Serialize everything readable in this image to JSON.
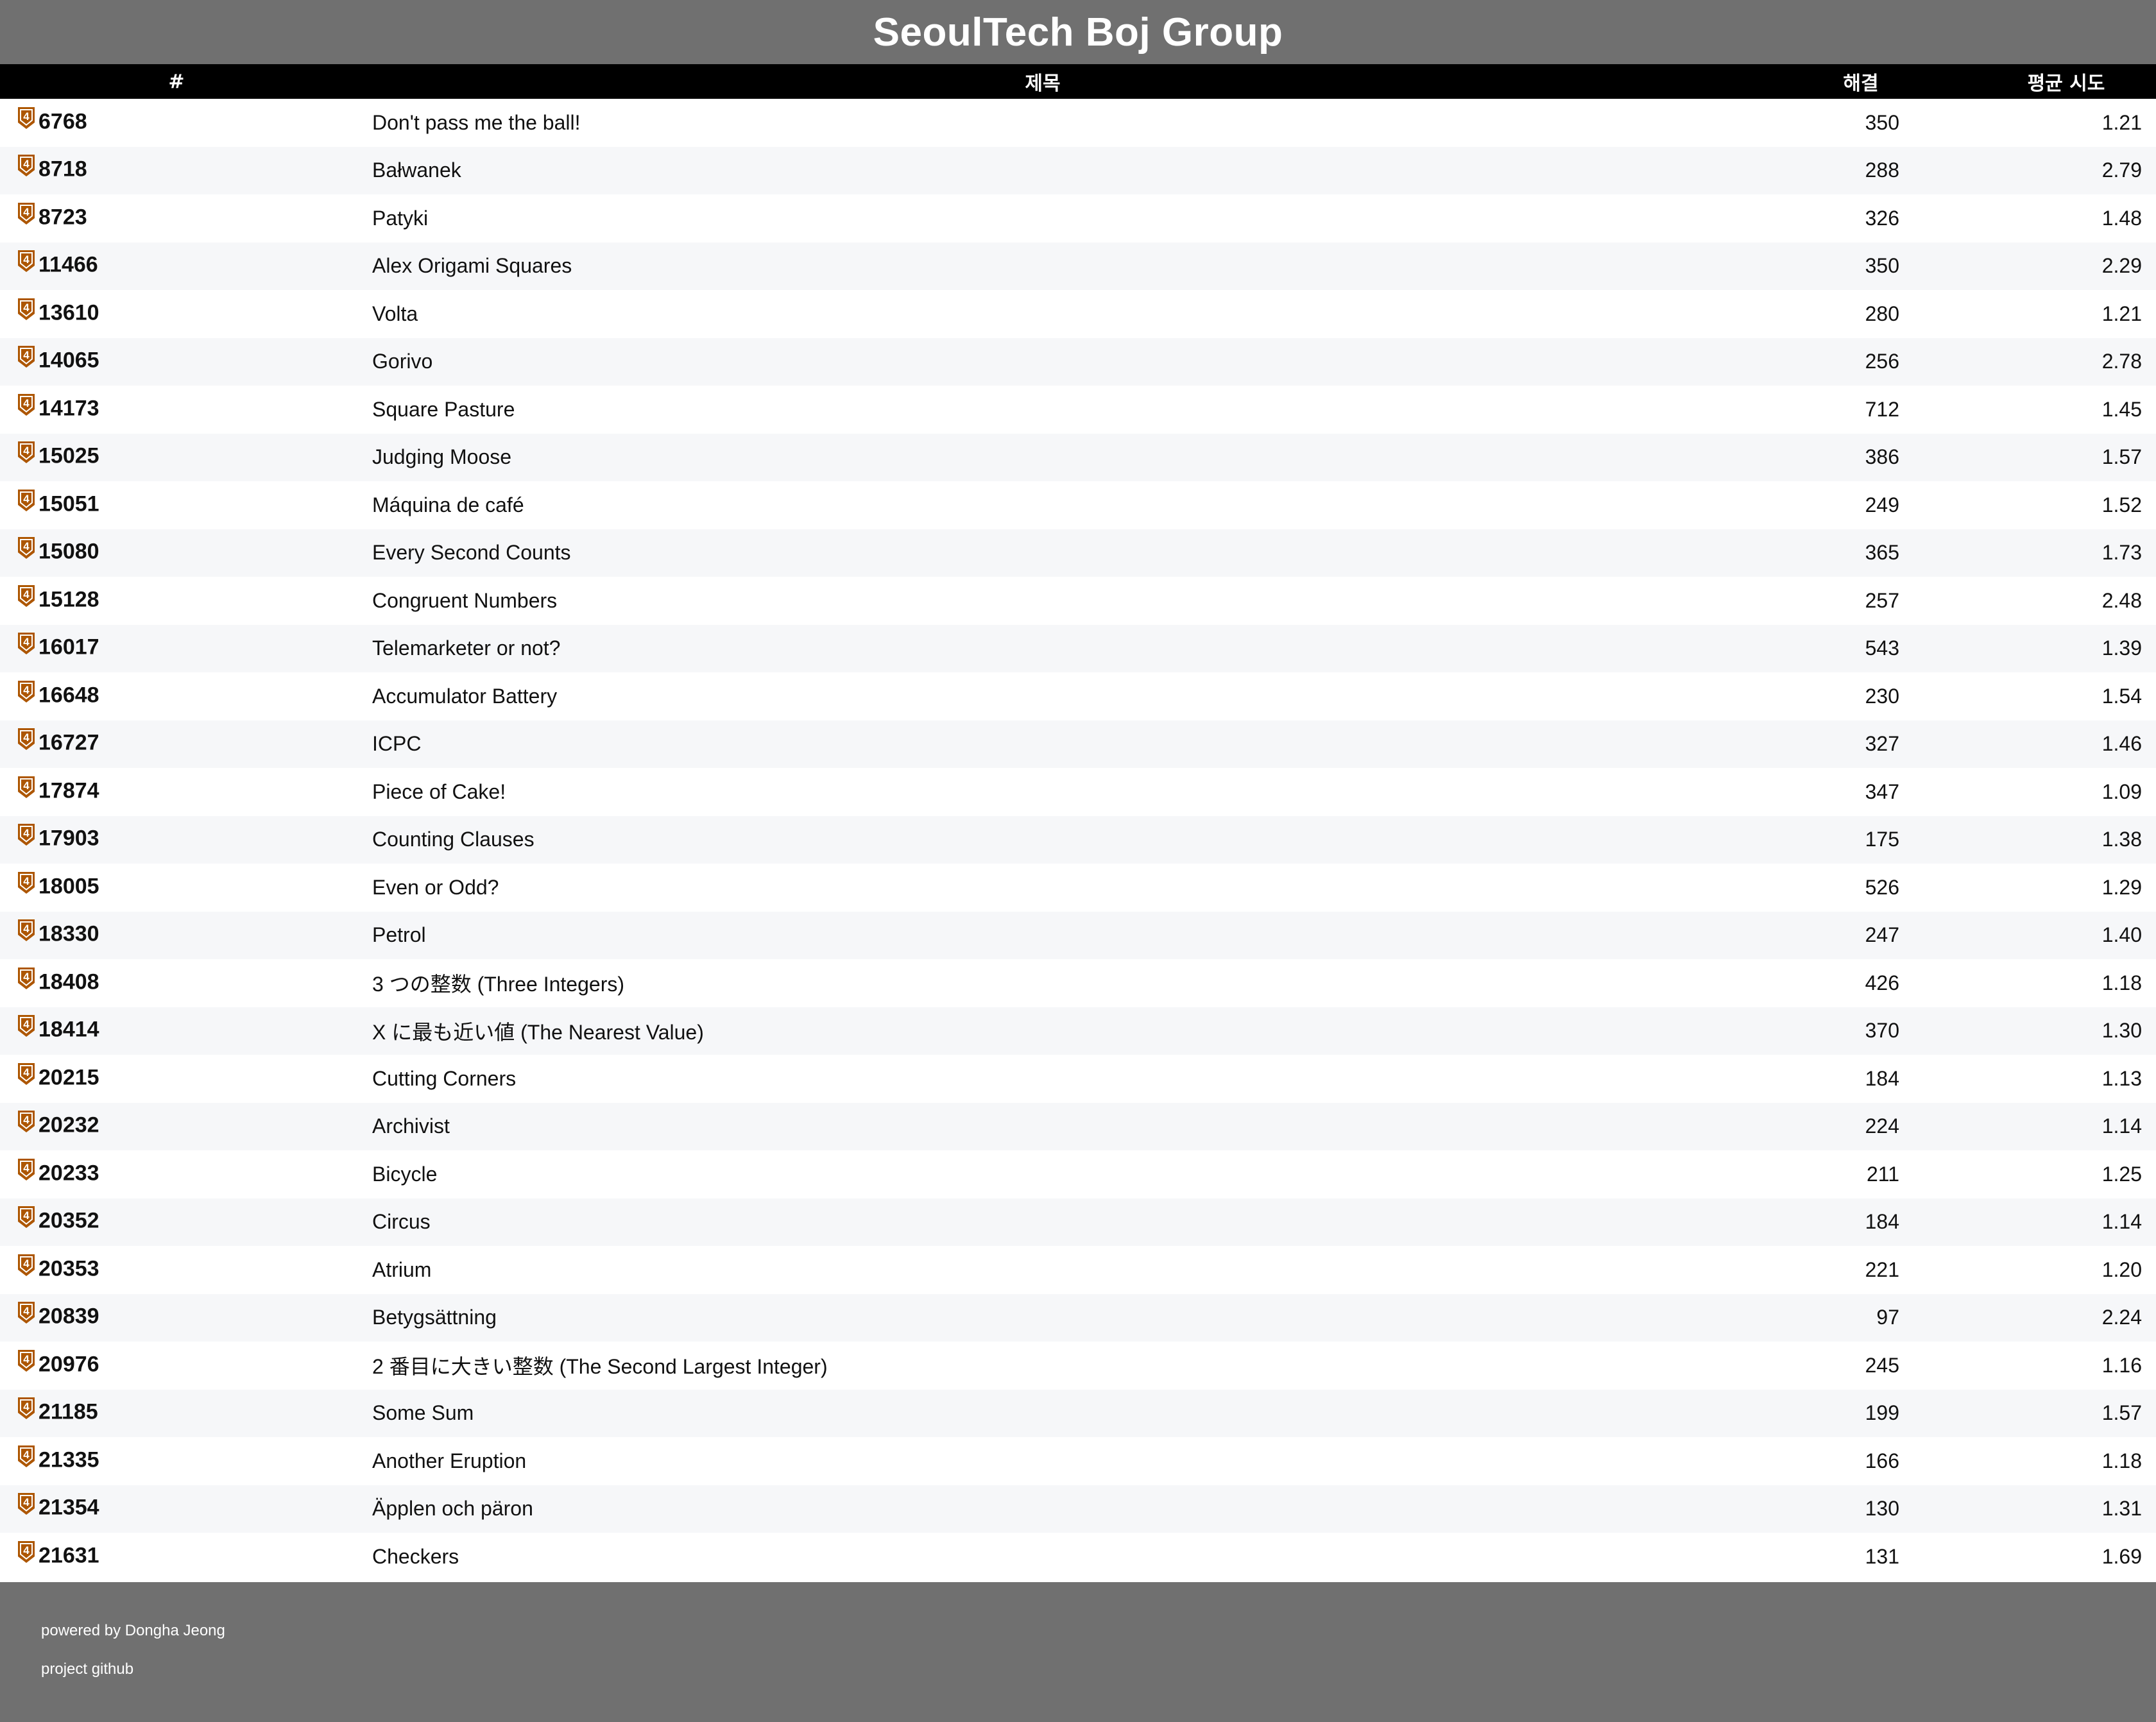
{
  "header": {
    "title": "SeoulTech Boj Group"
  },
  "table": {
    "columns": {
      "id": "#",
      "title": "제목",
      "solved": "해결",
      "avg_tries": "평균 시도"
    },
    "tier_badge": {
      "label": "4",
      "color": "#ad5600",
      "icon": "bronze-tier-4-icon"
    },
    "rows": [
      {
        "id": "6768",
        "title": "Don't pass me the ball!",
        "solved": "350",
        "avg": "1.21"
      },
      {
        "id": "8718",
        "title": "Bałwanek",
        "solved": "288",
        "avg": "2.79"
      },
      {
        "id": "8723",
        "title": "Patyki",
        "solved": "326",
        "avg": "1.48"
      },
      {
        "id": "11466",
        "title": "Alex Origami Squares",
        "solved": "350",
        "avg": "2.29"
      },
      {
        "id": "13610",
        "title": "Volta",
        "solved": "280",
        "avg": "1.21"
      },
      {
        "id": "14065",
        "title": "Gorivo",
        "solved": "256",
        "avg": "2.78"
      },
      {
        "id": "14173",
        "title": "Square Pasture",
        "solved": "712",
        "avg": "1.45"
      },
      {
        "id": "15025",
        "title": "Judging Moose",
        "solved": "386",
        "avg": "1.57"
      },
      {
        "id": "15051",
        "title": "Máquina de café",
        "solved": "249",
        "avg": "1.52"
      },
      {
        "id": "15080",
        "title": "Every Second Counts",
        "solved": "365",
        "avg": "1.73"
      },
      {
        "id": "15128",
        "title": "Congruent Numbers",
        "solved": "257",
        "avg": "2.48"
      },
      {
        "id": "16017",
        "title": "Telemarketer or not?",
        "solved": "543",
        "avg": "1.39"
      },
      {
        "id": "16648",
        "title": "Accumulator Battery",
        "solved": "230",
        "avg": "1.54"
      },
      {
        "id": "16727",
        "title": "ICPC",
        "solved": "327",
        "avg": "1.46"
      },
      {
        "id": "17874",
        "title": "Piece of Cake!",
        "solved": "347",
        "avg": "1.09"
      },
      {
        "id": "17903",
        "title": "Counting Clauses",
        "solved": "175",
        "avg": "1.38"
      },
      {
        "id": "18005",
        "title": "Even or Odd?",
        "solved": "526",
        "avg": "1.29"
      },
      {
        "id": "18330",
        "title": "Petrol",
        "solved": "247",
        "avg": "1.40"
      },
      {
        "id": "18408",
        "title": "3 つの整数 (Three Integers)",
        "solved": "426",
        "avg": "1.18"
      },
      {
        "id": "18414",
        "title": "X に最も近い値 (The Nearest Value)",
        "solved": "370",
        "avg": "1.30"
      },
      {
        "id": "20215",
        "title": "Cutting Corners",
        "solved": "184",
        "avg": "1.13"
      },
      {
        "id": "20232",
        "title": "Archivist",
        "solved": "224",
        "avg": "1.14"
      },
      {
        "id": "20233",
        "title": "Bicycle",
        "solved": "211",
        "avg": "1.25"
      },
      {
        "id": "20352",
        "title": "Circus",
        "solved": "184",
        "avg": "1.14"
      },
      {
        "id": "20353",
        "title": "Atrium",
        "solved": "221",
        "avg": "1.20"
      },
      {
        "id": "20839",
        "title": "Betygsättning",
        "solved": "97",
        "avg": "2.24"
      },
      {
        "id": "20976",
        "title": "2 番目に大きい整数 (The Second Largest Integer)",
        "solved": "245",
        "avg": "1.16"
      },
      {
        "id": "21185",
        "title": "Some Sum",
        "solved": "199",
        "avg": "1.57"
      },
      {
        "id": "21335",
        "title": "Another Eruption",
        "solved": "166",
        "avg": "1.18"
      },
      {
        "id": "21354",
        "title": "Äpplen och päron",
        "solved": "130",
        "avg": "1.31"
      },
      {
        "id": "21631",
        "title": "Checkers",
        "solved": "131",
        "avg": "1.69"
      }
    ]
  },
  "footer": {
    "powered_by": "powered by Dongha Jeong",
    "github_link": "project github"
  }
}
